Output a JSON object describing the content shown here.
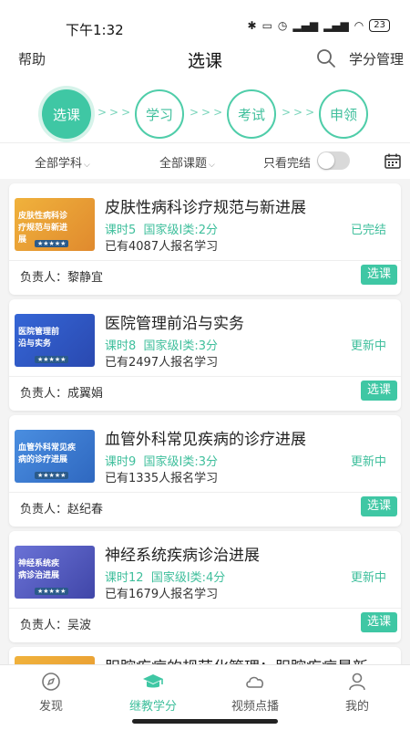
{
  "status": {
    "time": "下午1:32",
    "battery": "23"
  },
  "header": {
    "help": "帮助",
    "title": "选课",
    "credit": "学分管理"
  },
  "steps": [
    "选课",
    "学习",
    "考试",
    "申领"
  ],
  "filters": {
    "subject": "全部学科",
    "topic": "全部课题",
    "completed_only": "只看完结",
    "completed_only_on": false
  },
  "courses": [
    {
      "title": "皮肤性病科诊疗规范与新进展",
      "hours": "课时5",
      "level": "国家级Ⅰ类:2分",
      "enrolled": "已有4087人报名学习",
      "status": "已完结",
      "owner": "负责人：黎静宜",
      "action": "选课",
      "thumb_text": "皮肤性病科诊疗规范与新进展",
      "thumb_color": "#e8a23a",
      "stars": "★★★★★"
    },
    {
      "title": "医院管理前沿与实务",
      "hours": "课时8",
      "level": "国家级Ⅰ类:3分",
      "enrolled": "已有2497人报名学习",
      "status": "更新中",
      "owner": "负责人：成翼娟",
      "action": "选课",
      "thumb_text": "医院管理前沿与实务",
      "thumb_color": "#3b6fd8",
      "stars": "★★★★★"
    },
    {
      "title": "血管外科常见疾病的诊疗进展",
      "hours": "课时9",
      "level": "国家级Ⅰ类:3分",
      "enrolled": "已有1335人报名学习",
      "status": "更新中",
      "owner": "负责人：赵纪春",
      "action": "选课",
      "thumb_text": "血管外科常见疾病的诊疗进展",
      "thumb_color": "#3f7fd0",
      "stars": "★★★★★"
    },
    {
      "title": "神经系统疾病诊治进展",
      "hours": "课时12",
      "level": "国家级Ⅰ类:4分",
      "enrolled": "已有1679人报名学习",
      "status": "更新中",
      "owner": "负责人：吴波",
      "action": "选课",
      "thumb_text": "神经系统疾病诊治进展",
      "thumb_color": "#5a63c8",
      "stars": "★★★★★"
    }
  ],
  "partial_course": {
    "title": "胆腔疾病的规范化管理：胆腔疾病最新"
  },
  "tabs": [
    {
      "label": "发现",
      "icon": "compass-icon"
    },
    {
      "label": "继教学分",
      "icon": "graduation-cap-icon"
    },
    {
      "label": "视频点播",
      "icon": "cloud-icon"
    },
    {
      "label": "我的",
      "icon": "person-icon"
    }
  ],
  "colors": {
    "accent": "#3fc7a4",
    "accent_text": "#3fbf9c"
  }
}
